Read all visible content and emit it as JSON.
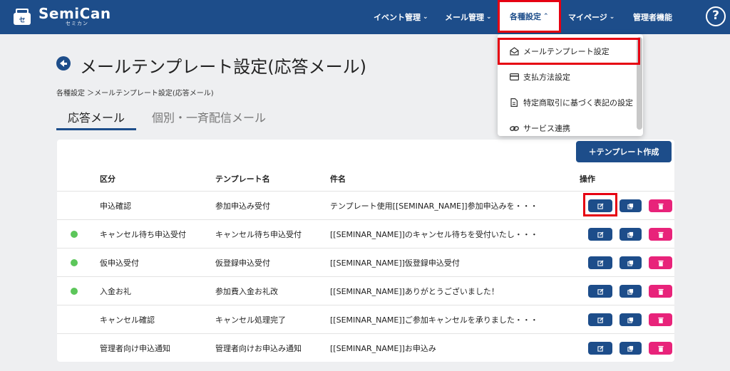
{
  "header": {
    "logo_name": "SemiCan",
    "logo_sub": "セミカン",
    "nav": [
      {
        "label": "イベント管理",
        "has_chevron": true
      },
      {
        "label": "メール管理",
        "has_chevron": true
      },
      {
        "label": "各種設定",
        "has_chevron": true
      },
      {
        "label": "マイページ",
        "has_chevron": true
      },
      {
        "label": "管理者機能",
        "has_chevron": false
      }
    ],
    "help_label": "?"
  },
  "dropdown": {
    "items": [
      {
        "label": "メールテンプレート設定",
        "icon": "envelope-open-icon"
      },
      {
        "label": "支払方法設定",
        "icon": "credit-card-icon"
      },
      {
        "label": "特定商取引に基づく表記の設定",
        "icon": "document-icon"
      },
      {
        "label": "サービス連携",
        "icon": "link-icon"
      }
    ]
  },
  "page": {
    "title": "メールテンプレート設定(応答メール)",
    "breadcrumb": "各種設定 ＞メールテンプレート設定(応答メール)",
    "tabs": [
      {
        "label": "応答メール",
        "active": true
      },
      {
        "label": "個別・一斉配信メール",
        "active": false
      }
    ],
    "create_button": "＋テンプレート作成"
  },
  "table": {
    "headers": [
      "区分",
      "テンプレート名",
      "件名",
      "操作"
    ],
    "rows": [
      {
        "status_dot": false,
        "category": "申込確認",
        "template_name": "参加申込み受付",
        "subject": "テンプレート使用[[SEMINAR_NAME]]参加申込みを・・・"
      },
      {
        "status_dot": true,
        "category": "キャンセル待ち申込受付",
        "template_name": "キャンセル待ち申込受付",
        "subject": "[[SEMINAR_NAME]]のキャンセル待ちを受付いたし・・・"
      },
      {
        "status_dot": true,
        "category": "仮申込受付",
        "template_name": "仮登録申込受付",
        "subject": "[[SEMINAR_NAME]]仮登録申込受付"
      },
      {
        "status_dot": true,
        "category": "入金お礼",
        "template_name": "参加費入金お礼改",
        "subject": "[[SEMINAR_NAME]]ありがとうございました！"
      },
      {
        "status_dot": false,
        "category": "キャンセル確認",
        "template_name": "キャンセル処理完了",
        "subject": "[[SEMINAR_NAME]]ご参加キャンセルを承りました・・・"
      },
      {
        "status_dot": false,
        "category": "管理者向け申込通知",
        "template_name": "管理者向けお申込み通知",
        "subject": "[[SEMINAR_NAME]]お申込み"
      }
    ]
  },
  "colors": {
    "brand": "#1d4d8a",
    "delete": "#e8237a",
    "status_active": "#5cc65a",
    "highlight": "#e60012"
  }
}
